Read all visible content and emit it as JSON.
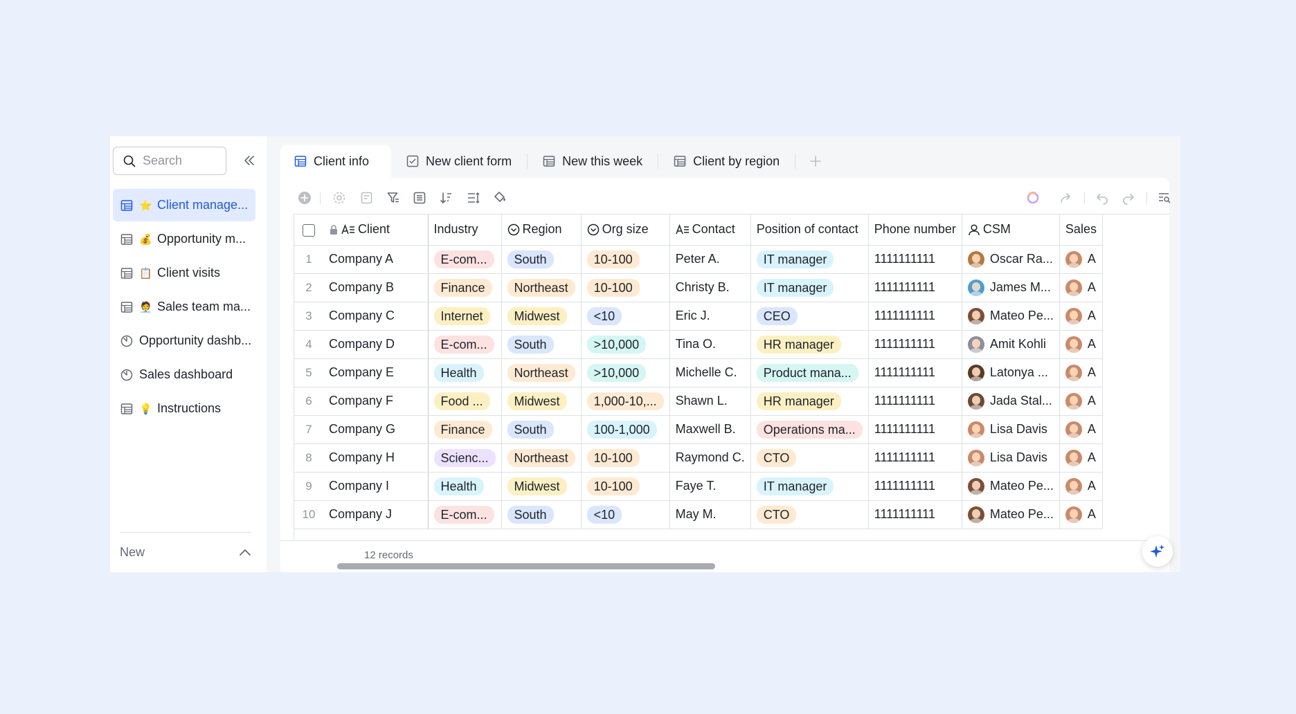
{
  "sidebar": {
    "search_placeholder": "Search",
    "items": [
      {
        "emoji": "⭐",
        "label": "Client manage...",
        "icon": "table-icon",
        "active": true
      },
      {
        "emoji": "💰",
        "label": "Opportunity m...",
        "icon": "table-icon"
      },
      {
        "emoji": "📋",
        "label": "Client visits",
        "icon": "table-icon"
      },
      {
        "emoji": "🧑‍💼",
        "label": "Sales team ma...",
        "icon": "table-icon"
      },
      {
        "emoji": "",
        "label": "Opportunity dashb...",
        "icon": "dashboard-icon"
      },
      {
        "emoji": "",
        "label": "Sales dashboard",
        "icon": "dashboard-icon"
      },
      {
        "emoji": "💡",
        "label": "Instructions",
        "icon": "table-icon"
      }
    ],
    "new_label": "New"
  },
  "tabs": [
    {
      "label": "Client info",
      "icon": "grid-view-icon",
      "active": true
    },
    {
      "label": "New client form",
      "icon": "form-view-icon"
    },
    {
      "label": "New this week",
      "icon": "grid-view-icon"
    },
    {
      "label": "Client by region",
      "icon": "grid-view-icon"
    }
  ],
  "columns": [
    "Client",
    "Industry",
    "Region",
    "Org size",
    "Contact",
    "Position of contact",
    "Phone number",
    "CSM",
    "Sales"
  ],
  "rows": [
    {
      "num": "1",
      "client": "Company A",
      "industry": "E-com...",
      "region": "South",
      "org": "10-100",
      "contact": "Peter A.",
      "position": "IT manager",
      "phone": "1111111111",
      "csm": "Oscar Ra...",
      "sales": "A"
    },
    {
      "num": "2",
      "client": "Company B",
      "industry": "Finance",
      "region": "Northeast",
      "org": "10-100",
      "contact": "Christy B.",
      "position": "IT manager",
      "phone": "1111111111",
      "csm": "James M...",
      "sales": "A"
    },
    {
      "num": "3",
      "client": "Company C",
      "industry": "Internet",
      "region": "Midwest",
      "org": "<10",
      "contact": "Eric J.",
      "position": "CEO",
      "phone": "1111111111",
      "csm": "Mateo Pe...",
      "sales": "A"
    },
    {
      "num": "4",
      "client": "Company D",
      "industry": "E-com...",
      "region": "South",
      "org": ">10,000",
      "contact": "Tina O.",
      "position": "HR manager",
      "phone": "1111111111",
      "csm": "Amit Kohli",
      "sales": "A"
    },
    {
      "num": "5",
      "client": "Company E",
      "industry": "Health",
      "region": "Northeast",
      "org": ">10,000",
      "contact": "Michelle C.",
      "position": "Product mana...",
      "phone": "1111111111",
      "csm": "Latonya ...",
      "sales": "A"
    },
    {
      "num": "6",
      "client": "Company F",
      "industry": "Food ...",
      "region": "Midwest",
      "org": "1,000-10,...",
      "contact": "Shawn L.",
      "position": "HR manager",
      "phone": "1111111111",
      "csm": "Jada Stal...",
      "sales": "A"
    },
    {
      "num": "7",
      "client": "Company G",
      "industry": "Finance",
      "region": "South",
      "org": "100-1,000",
      "contact": "Maxwell B.",
      "position": "Operations ma...",
      "phone": "1111111111",
      "csm": "Lisa Davis",
      "sales": "A"
    },
    {
      "num": "8",
      "client": "Company H",
      "industry": "Scienc...",
      "region": "Northeast",
      "org": "10-100",
      "contact": "Raymond C.",
      "position": "CTO",
      "phone": "1111111111",
      "csm": "Lisa Davis",
      "sales": "A"
    },
    {
      "num": "9",
      "client": "Company I",
      "industry": "Health",
      "region": "Midwest",
      "org": "10-100",
      "contact": "Faye T.",
      "position": "IT manager",
      "phone": "1111111111",
      "csm": "Mateo Pe...",
      "sales": "A"
    },
    {
      "num": "10",
      "client": "Company J",
      "industry": "E-com...",
      "region": "South",
      "org": "<10",
      "contact": "May M.",
      "position": "CTO",
      "phone": "1111111111",
      "csm": "Mateo Pe...",
      "sales": "A"
    }
  ],
  "footer": {
    "records": "12 records"
  },
  "colors": {
    "accent": "#245bdb",
    "pill_red": "#fde2e2",
    "pill_orange": "#feead2",
    "pill_yellow": "#fcf0c3",
    "pill_blue": "#d9e6fc",
    "pill_cyan": "#d5f6f2",
    "pill_purple": "#ece2fe",
    "pill_sky": "#d9f3fd"
  }
}
